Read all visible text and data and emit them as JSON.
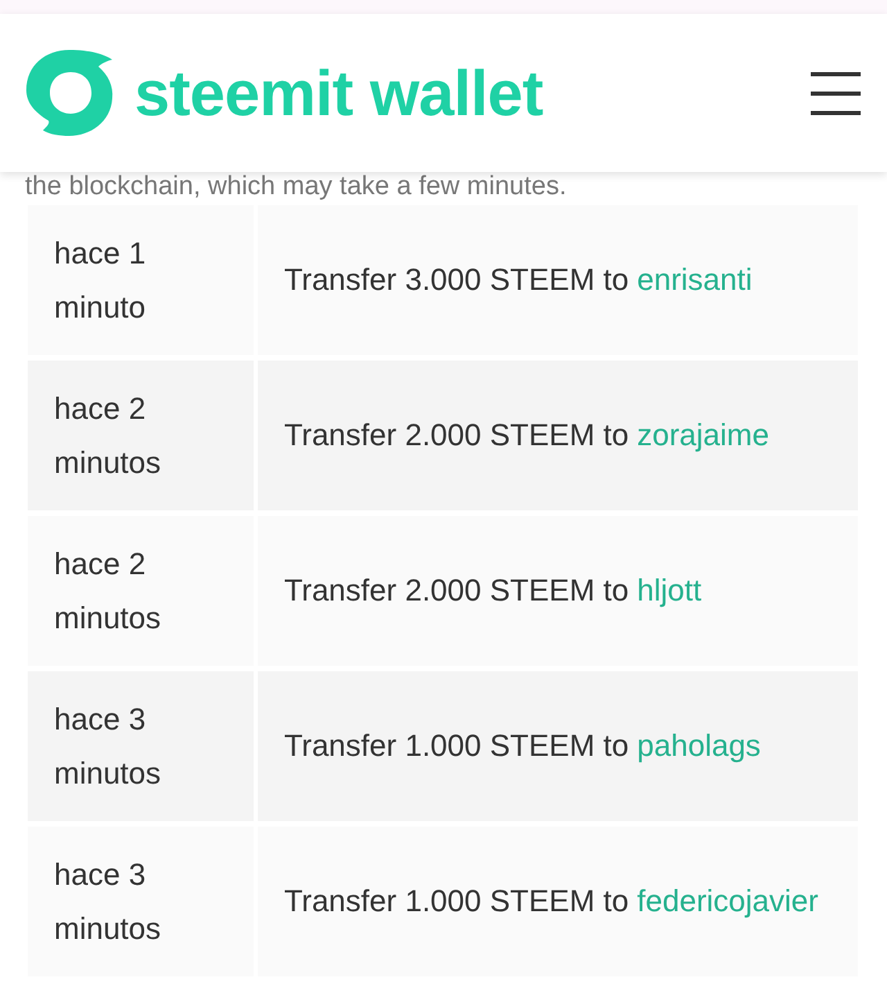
{
  "header": {
    "brand": "steemit wallet"
  },
  "notice": "the blockchain, which may take a few minutes.",
  "transfers": [
    {
      "time": "hace 1 minuto",
      "description": "Transfer 3.000 STEEM to",
      "recipient": "enrisanti"
    },
    {
      "time": "hace 2 minutos",
      "description": "Transfer 2.000 STEEM to",
      "recipient": "zorajaime"
    },
    {
      "time": "hace 2 minutos",
      "description": "Transfer 2.000 STEEM to",
      "recipient": "hljott"
    },
    {
      "time": "hace 3 minutos",
      "description": "Transfer 1.000 STEEM to",
      "recipient": "paholags"
    },
    {
      "time": "hace 3 minutos",
      "description": "Transfer 1.000 STEEM to",
      "recipient": "federicojavier"
    }
  ]
}
